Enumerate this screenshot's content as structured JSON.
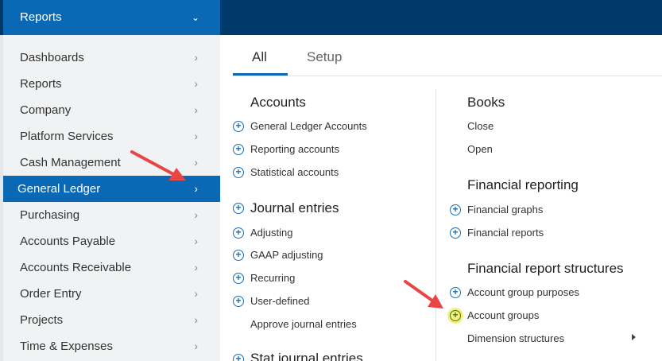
{
  "header": {
    "menu_label": "Reports",
    "chevron": "chevron-down-icon"
  },
  "sidebar": {
    "items": [
      {
        "label": "Dashboards"
      },
      {
        "label": "Reports"
      },
      {
        "label": "Company"
      },
      {
        "label": "Platform Services"
      },
      {
        "label": "Cash Management"
      },
      {
        "label": "General Ledger",
        "active": true
      },
      {
        "label": "Purchasing"
      },
      {
        "label": "Accounts Payable"
      },
      {
        "label": "Accounts Receivable"
      },
      {
        "label": "Order Entry"
      },
      {
        "label": "Projects"
      },
      {
        "label": "Time & Expenses"
      }
    ]
  },
  "tabs": {
    "all": "All",
    "setup": "Setup"
  },
  "col1": {
    "accounts": {
      "title": "Accounts",
      "items": [
        "General Ledger Accounts",
        "Reporting accounts",
        "Statistical accounts"
      ]
    },
    "journal": {
      "title": "Journal entries",
      "items": [
        "Adjusting",
        "GAAP adjusting",
        "Recurring",
        "User-defined",
        "Approve journal entries"
      ]
    },
    "stat": {
      "title": "Stat journal entries"
    }
  },
  "col2": {
    "books": {
      "title": "Books",
      "items": [
        "Close",
        "Open"
      ]
    },
    "fin_reporting": {
      "title": "Financial reporting",
      "items": [
        "Financial graphs",
        "Financial reports"
      ]
    },
    "fin_structures": {
      "title": "Financial report structures",
      "items": [
        "Account group purposes",
        "Account groups",
        "Dimension structures"
      ]
    }
  },
  "colors": {
    "primary": "#0a68b4",
    "topbar": "#003a6b",
    "sidebar_bg": "#f0f2f3",
    "arrow": "#e84545",
    "highlight": "#f4f07a"
  }
}
